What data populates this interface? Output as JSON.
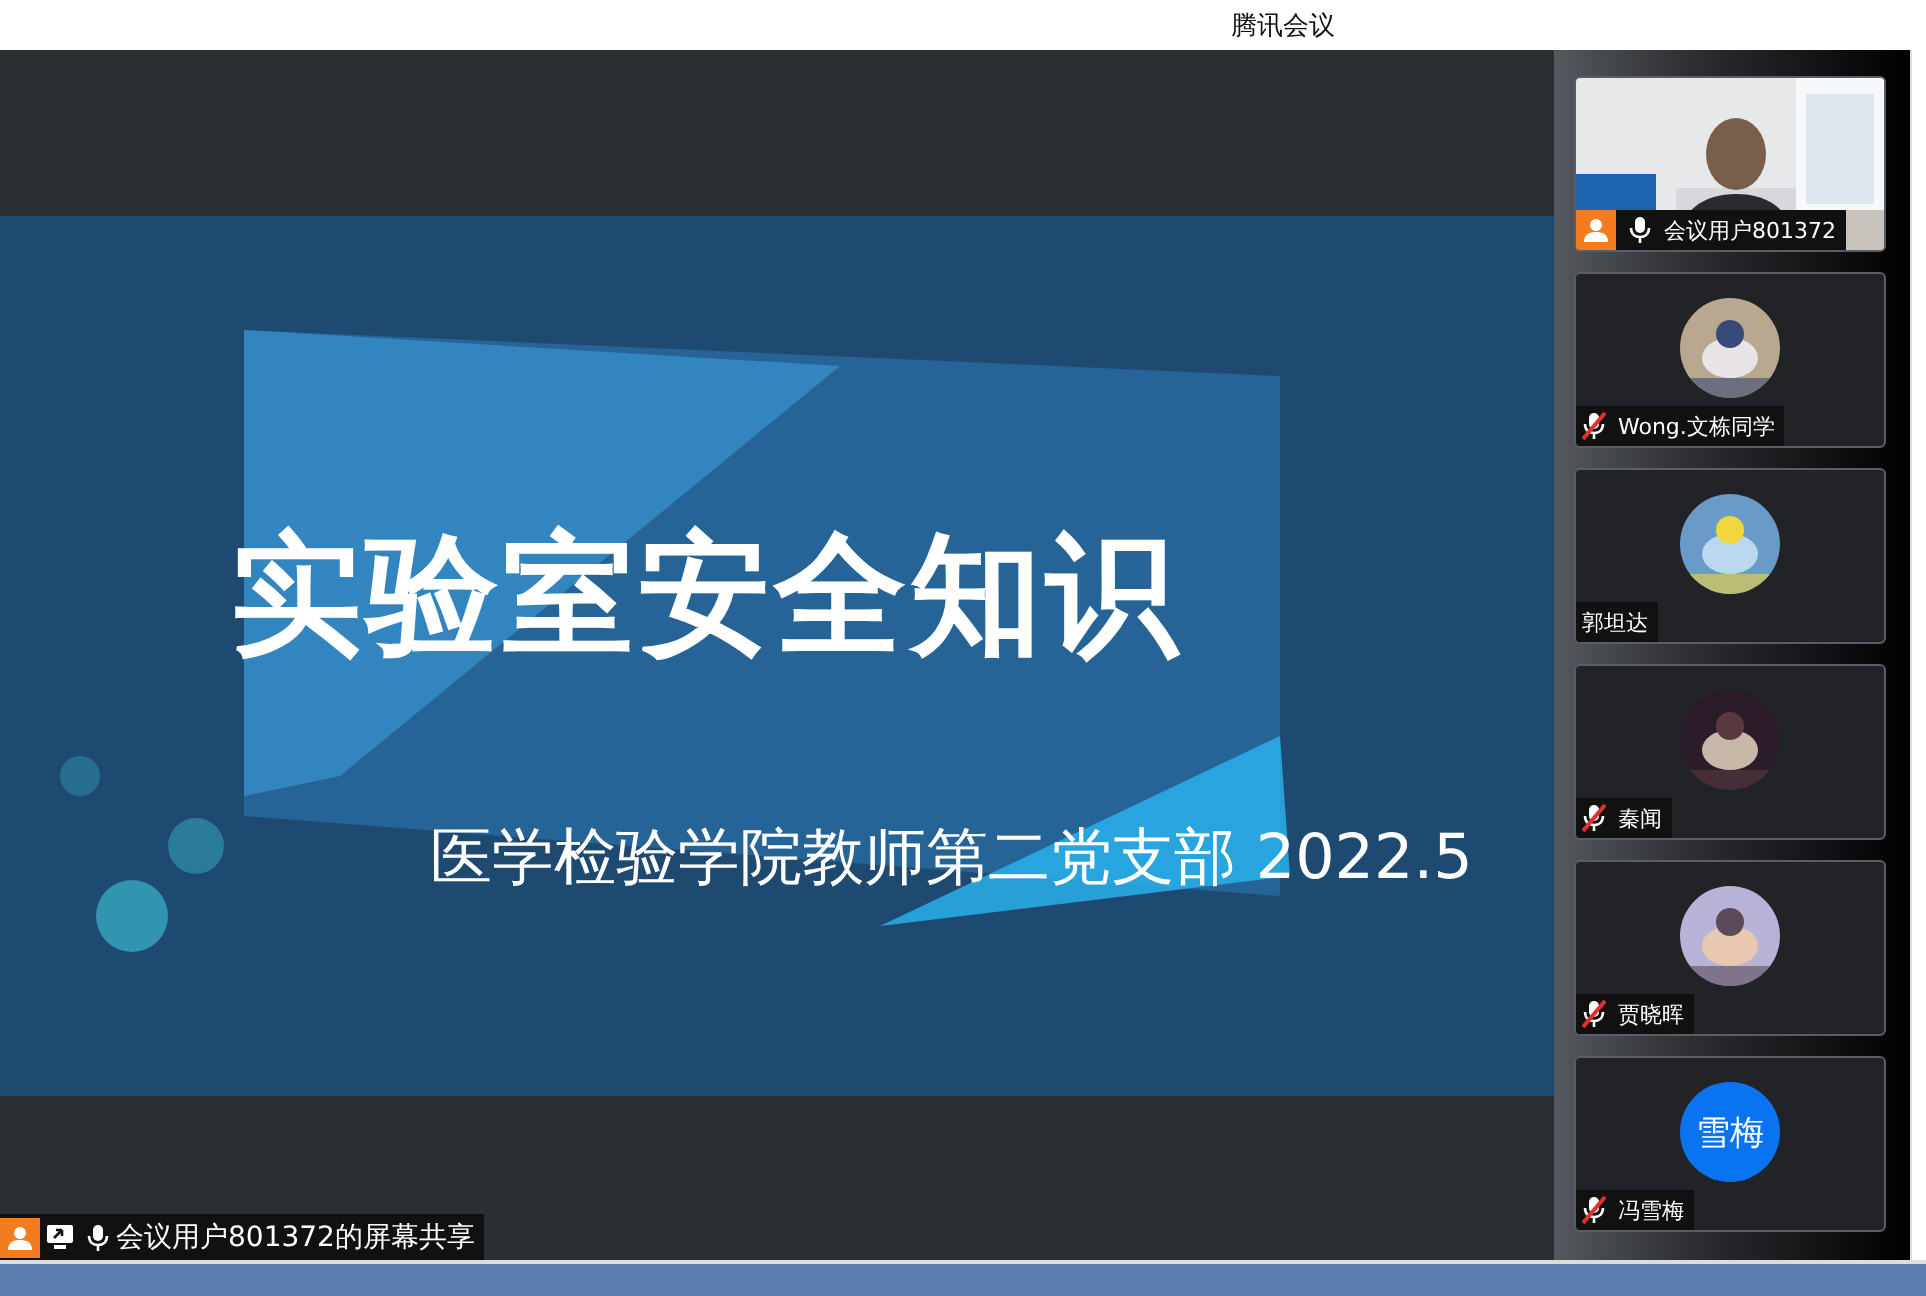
{
  "window": {
    "title": "腾讯会议"
  },
  "slide": {
    "title": "实验室安全知识",
    "subtitle": "医学检验学院教师第二党支部 2022.5"
  },
  "participants": [
    {
      "kind": "video",
      "name": "会议用户801372",
      "host": true,
      "muted": false
    },
    {
      "kind": "avatar",
      "name": "Wong.文栋同学",
      "host": false,
      "muted": true
    },
    {
      "kind": "avatar",
      "name": "郭坦达",
      "host": false
    },
    {
      "kind": "avatar",
      "name": "秦闻",
      "host": false,
      "muted": true
    },
    {
      "kind": "avatar",
      "name": "贾晓晖",
      "host": false,
      "muted": true
    },
    {
      "kind": "initials",
      "initials": "雪梅",
      "name": "冯雪梅",
      "host": false,
      "muted": true
    }
  ],
  "share_label": {
    "text": "会议用户801372的屏幕共享",
    "host": true,
    "muted": false
  }
}
